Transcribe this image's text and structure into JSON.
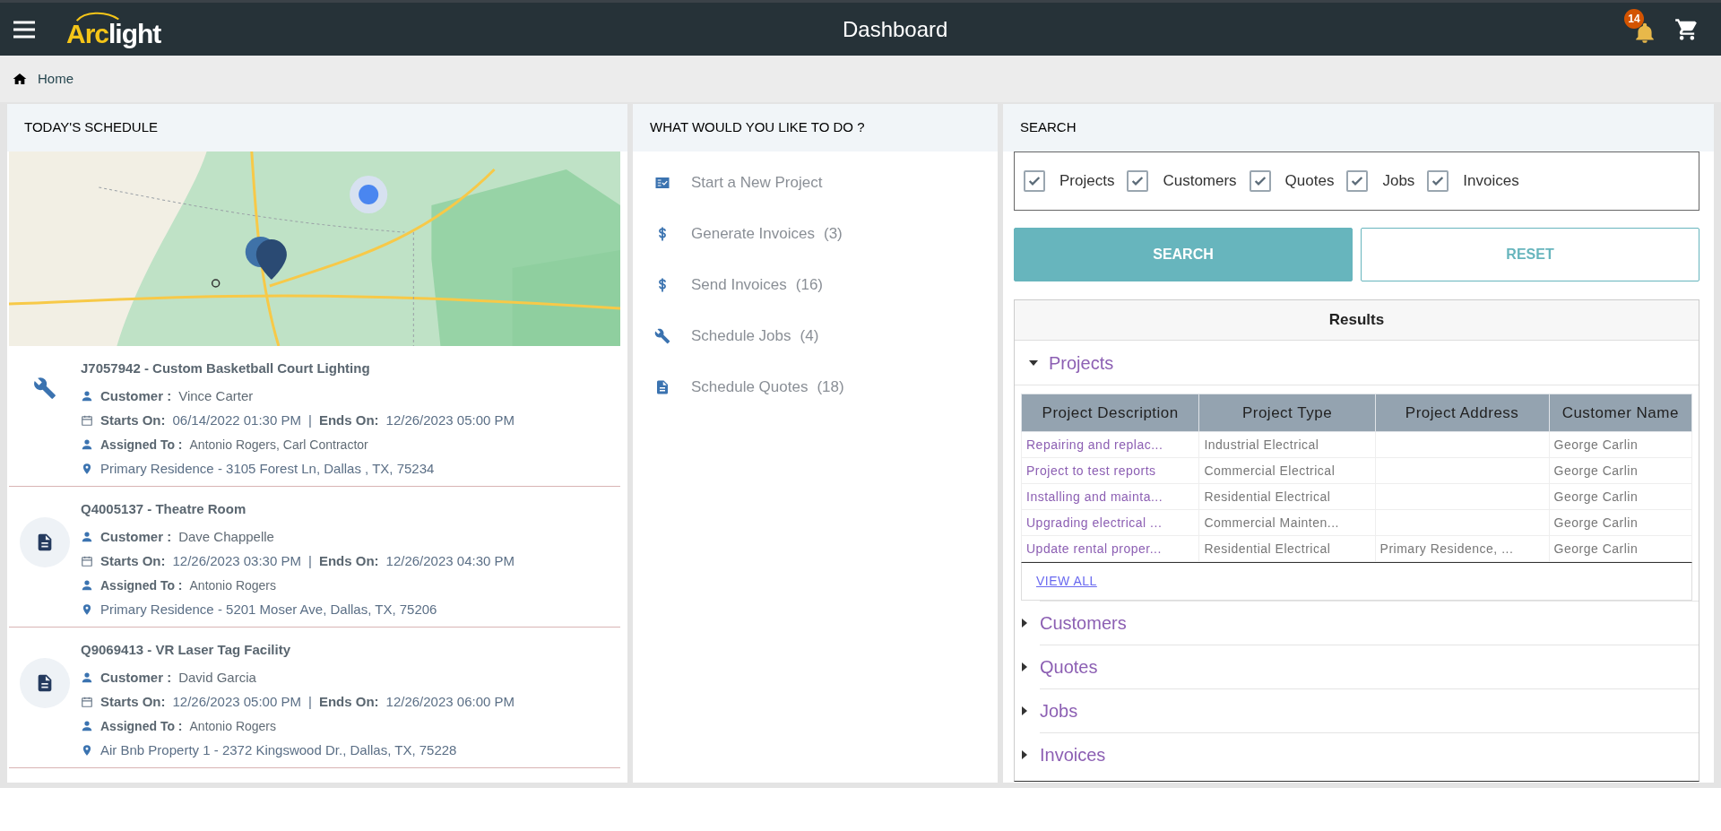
{
  "header": {
    "logo": "Arclight",
    "title": "Dashboard",
    "notification_count": "14"
  },
  "breadcrumb": {
    "label": "Home"
  },
  "schedule": {
    "title": "TODAY'S SCHEDULE",
    "items": [
      {
        "kind": "job",
        "title": "J7057942 - Custom Basketball Court Lighting",
        "customer_label": "Customer :",
        "customer": "Vince Carter",
        "starts_label": "Starts On:",
        "starts": "06/14/2022 01:30 PM",
        "separator": "|",
        "ends_label": "Ends On:",
        "ends": "12/26/2023 05:00 PM",
        "assigned_label": "Assigned To :",
        "assigned": "Antonio Rogers, Carl Contractor",
        "address": "Primary Residence - 3105 Forest Ln, Dallas , TX, 75234"
      },
      {
        "kind": "quote",
        "title": "Q4005137 - Theatre Room",
        "customer_label": "Customer :",
        "customer": "Dave Chappelle",
        "starts_label": "Starts On:",
        "starts": "12/26/2023 03:30 PM",
        "separator": "|",
        "ends_label": "Ends On:",
        "ends": "12/26/2023 04:30 PM",
        "assigned_label": "Assigned To :",
        "assigned": "Antonio Rogers",
        "address": "Primary Residence - 5201 Moser Ave, Dallas, TX, 75206"
      },
      {
        "kind": "quote",
        "title": "Q9069413 - VR Laser Tag Facility",
        "customer_label": "Customer :",
        "customer": "David Garcia",
        "starts_label": "Starts On:",
        "starts": "12/26/2023 05:00 PM",
        "separator": "|",
        "ends_label": "Ends On:",
        "ends": "12/26/2023 06:00 PM",
        "assigned_label": "Assigned To :",
        "assigned": "Antonio Rogers",
        "address": "Air Bnb Property 1 - 2372 Kingswood Dr., Dallas, TX, 75228"
      }
    ]
  },
  "actions": {
    "title": "WHAT WOULD YOU LIKE TO DO ?",
    "items": [
      {
        "kind": "checklist",
        "label": "Start a New Project"
      },
      {
        "kind": "dollar",
        "label": "Generate Invoices",
        "count": "(3)"
      },
      {
        "kind": "dollar",
        "label": "Send Invoices",
        "count": "(16)"
      },
      {
        "kind": "wrench",
        "label": "Schedule Jobs",
        "count": "(4)"
      },
      {
        "kind": "document",
        "label": "Schedule Quotes",
        "count": "(18)"
      }
    ]
  },
  "search": {
    "title": "SEARCH",
    "filters": [
      {
        "label": "Projects",
        "checked": true
      },
      {
        "label": "Customers",
        "checked": true
      },
      {
        "label": "Quotes",
        "checked": true
      },
      {
        "label": "Jobs",
        "checked": true
      },
      {
        "label": "Invoices",
        "checked": true
      }
    ],
    "buttons": [
      {
        "kind": "primary",
        "label": "SEARCH"
      },
      {
        "kind": "outline",
        "label": "RESET"
      }
    ],
    "results": {
      "title": "Results",
      "sections": [
        {
          "title": "Projects",
          "expanded": true,
          "table": {
            "columns": [
              "Project Description",
              "Project Type",
              "Project Address",
              "Customer Name"
            ],
            "rows": [
              [
                "Repairing and replac...",
                "Industrial Electrical",
                "",
                "George Carlin"
              ],
              [
                "Project to test reports",
                "Commercial Electrical",
                "",
                "George Carlin"
              ],
              [
                "Installing and mainta...",
                "Residential Electrical",
                "",
                "George Carlin"
              ],
              [
                "Upgrading electrical ...",
                "Commercial Mainten...",
                "",
                "George Carlin"
              ],
              [
                "Update rental proper...",
                "Residential Electrical",
                "Primary Residence, ...",
                "George Carlin"
              ]
            ]
          },
          "view_all": "VIEW ALL"
        },
        {
          "title": "Customers",
          "expanded": false
        },
        {
          "title": "Quotes",
          "expanded": false
        },
        {
          "title": "Jobs",
          "expanded": false
        },
        {
          "title": "Invoices",
          "expanded": false
        }
      ]
    }
  }
}
